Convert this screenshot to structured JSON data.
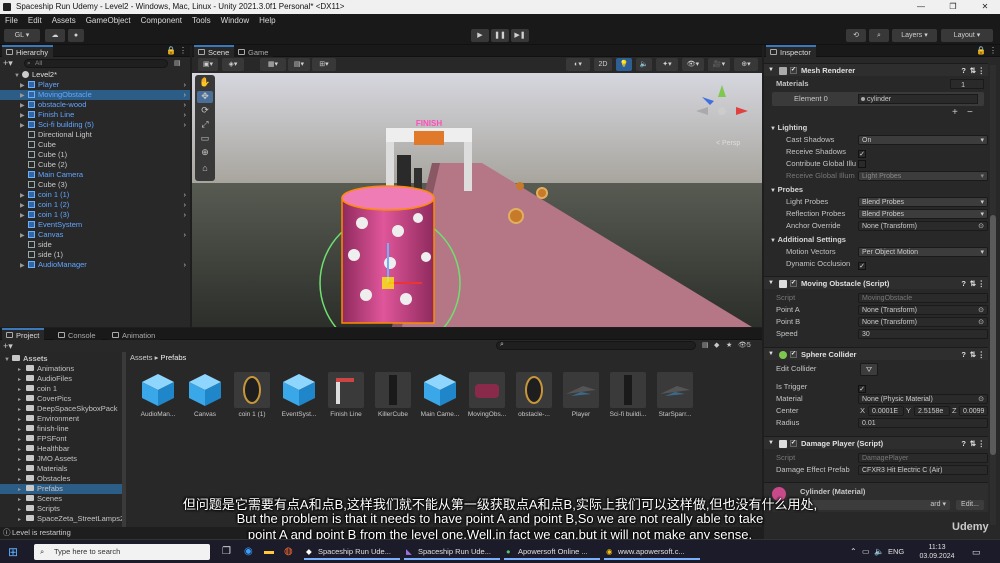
{
  "window": {
    "title": "Spaceship Run Udemy - Level2 - Windows, Mac, Linux - Unity 2021.3.0f1 Personal* <DX11>"
  },
  "menu": [
    "File",
    "Edit",
    "Assets",
    "GameObject",
    "Component",
    "Tools",
    "Window",
    "Help"
  ],
  "toolbar": {
    "account": "GL",
    "layers": "Layers",
    "layout": "Layout"
  },
  "hierarchy": {
    "tab": "Hierarchy",
    "search_placeholder": "All",
    "scene": "Level2*",
    "items": [
      {
        "label": "Player",
        "blue": true,
        "indent": 1,
        "arrow": true
      },
      {
        "label": "MovingObstacle",
        "blue": true,
        "indent": 1,
        "arrow": true,
        "selected": true
      },
      {
        "label": "obstacle-wood",
        "blue": true,
        "indent": 1,
        "arrow": true
      },
      {
        "label": "Finish Line",
        "blue": true,
        "indent": 1,
        "arrow": true
      },
      {
        "label": "Sci-fi building (5)",
        "blue": true,
        "indent": 1,
        "arrow": true
      },
      {
        "label": "Directional Light",
        "blue": false,
        "indent": 1
      },
      {
        "label": "Cube",
        "blue": false,
        "indent": 1
      },
      {
        "label": "Cube (1)",
        "blue": false,
        "indent": 1
      },
      {
        "label": "Cube (2)",
        "blue": false,
        "indent": 1
      },
      {
        "label": "Main Camera",
        "blue": true,
        "indent": 1
      },
      {
        "label": "Cube (3)",
        "blue": false,
        "indent": 1
      },
      {
        "label": "coin 1 (1)",
        "blue": true,
        "indent": 1,
        "arrow": true
      },
      {
        "label": "coin 1 (2)",
        "blue": true,
        "indent": 1,
        "arrow": true
      },
      {
        "label": "coin 1 (3)",
        "blue": true,
        "indent": 1,
        "arrow": true
      },
      {
        "label": "EventSystem",
        "blue": true,
        "indent": 1
      },
      {
        "label": "Canvas",
        "blue": true,
        "indent": 1,
        "arrow": true
      },
      {
        "label": "side",
        "blue": false,
        "indent": 1
      },
      {
        "label": "side (1)",
        "blue": false,
        "indent": 1
      },
      {
        "label": "AudioManager",
        "blue": true,
        "indent": 1,
        "arrow": true
      }
    ]
  },
  "scene": {
    "tabs": [
      "Scene",
      "Game"
    ],
    "mode_2d": "2D",
    "persp": "< Persp",
    "finish_sign": "FINISH"
  },
  "project": {
    "tabs": [
      "Project",
      "Console",
      "Animation"
    ],
    "breadcrumb": [
      "Assets",
      "Prefabs"
    ],
    "count": "5",
    "tree": [
      {
        "label": "Assets",
        "level": 0,
        "bold": true
      },
      {
        "label": "Animations",
        "level": 1
      },
      {
        "label": "AudioFiles",
        "level": 1
      },
      {
        "label": "coin 1",
        "level": 1
      },
      {
        "label": "CoverPics",
        "level": 1
      },
      {
        "label": "DeepSpaceSkyboxPack",
        "level": 1
      },
      {
        "label": "Environment",
        "level": 1
      },
      {
        "label": "finish-line",
        "level": 1
      },
      {
        "label": "FPSFont",
        "level": 1
      },
      {
        "label": "Healthbar",
        "level": 1
      },
      {
        "label": "JMO Assets",
        "level": 1
      },
      {
        "label": "Materials",
        "level": 1
      },
      {
        "label": "Obstacles",
        "level": 1
      },
      {
        "label": "Prefabs",
        "level": 1,
        "selected": true
      },
      {
        "label": "Scenes",
        "level": 1
      },
      {
        "label": "Scripts",
        "level": 1
      },
      {
        "label": "SpaceZeta_StreetLamps2",
        "level": 1
      }
    ],
    "assets": [
      {
        "label": "AudioMan...",
        "kind": "cube"
      },
      {
        "label": "Canvas",
        "kind": "cube"
      },
      {
        "label": "coin 1 (1)",
        "kind": "coin"
      },
      {
        "label": "EventSyst...",
        "kind": "cube"
      },
      {
        "label": "Finish Line",
        "kind": "gate"
      },
      {
        "label": "KillerCube",
        "kind": "tall"
      },
      {
        "label": "Main Came...",
        "kind": "cube"
      },
      {
        "label": "MovingObs...",
        "kind": "barrel"
      },
      {
        "label": "obstacle-...",
        "kind": "coin"
      },
      {
        "label": "Player",
        "kind": "ship"
      },
      {
        "label": "Sci-fi buildi...",
        "kind": "tall"
      },
      {
        "label": "StarSparr...",
        "kind": "ship"
      }
    ],
    "status": "Level is restarting"
  },
  "inspector": {
    "tab": "Inspector",
    "mesh_renderer": {
      "title": "Mesh Renderer",
      "materials_label": "Materials",
      "materials_count": "1",
      "element0": "Element 0",
      "element0_value": "cylinder"
    },
    "lighting": {
      "title": "Lighting",
      "cast_shadows": "Cast Shadows",
      "cast_shadows_value": "On",
      "receive_shadows": "Receive Shadows",
      "contribute_gi": "Contribute Global Illu",
      "receive_gi": "Receive Global Illum",
      "receive_gi_value": "Light Probes"
    },
    "probes": {
      "title": "Probes",
      "light_probes": "Light Probes",
      "light_probes_value": "Blend Probes",
      "reflection_probes": "Reflection Probes",
      "reflection_probes_value": "Blend Probes",
      "anchor": "Anchor Override",
      "anchor_value": "None (Transform)"
    },
    "additional": {
      "title": "Additional Settings",
      "motion_vectors": "Motion Vectors",
      "motion_vectors_value": "Per Object Motion",
      "dynamic_occlusion": "Dynamic Occlusion"
    },
    "moving_obstacle": {
      "title": "Moving Obstacle (Script)",
      "script_label": "Script",
      "script_value": "MovingObstacle",
      "point_a": "Point A",
      "point_a_value": "None (Transform)",
      "point_b": "Point B",
      "point_b_value": "None (Transform)",
      "speed": "Speed",
      "speed_value": "30"
    },
    "sphere_collider": {
      "title": "Sphere Collider",
      "edit_collider": "Edit Collider",
      "is_trigger": "Is Trigger",
      "material": "Material",
      "material_value": "None (Physic Material)",
      "center": "Center",
      "cx": "X",
      "cx_value": "0.0001E",
      "cy": "Y",
      "cy_value": "2.5158e",
      "cz": "Z",
      "cz_value": "0.0099",
      "radius": "Radius",
      "radius_value": "0.01"
    },
    "damage_player": {
      "title": "Damage Player (Script)",
      "script_label": "Script",
      "script_value": "DamagePlayer",
      "effect": "Damage Effect Prefab",
      "effect_value": "CFXR3 Hit Electric C (Air)"
    },
    "material_preview": {
      "title": "Cylinder (Material)",
      "shader_suffix": "ard",
      "edit": "Edit..."
    }
  },
  "subtitles": {
    "zh": "但问题是它需要有点A和点B,这样我们就不能从第一级获取点A和点B,实际上我们可以这样做,但也没有什么用处,",
    "en1": "But the problem is that it needs to have point A and point B,So we are not really able to take",
    "en2": "point A and point B from the level one,Well,in fact we can,but it will not make any sense,"
  },
  "taskbar": {
    "search": "Type here to search",
    "apps": [
      "Spaceship Run Ude...",
      "Spaceship Run Ude...",
      "Apowersoft Online ...",
      "www.apowersoft.c..."
    ],
    "lang": "ENG",
    "time": "11:13",
    "date": "03.09.2024"
  },
  "watermark": "Udemy"
}
